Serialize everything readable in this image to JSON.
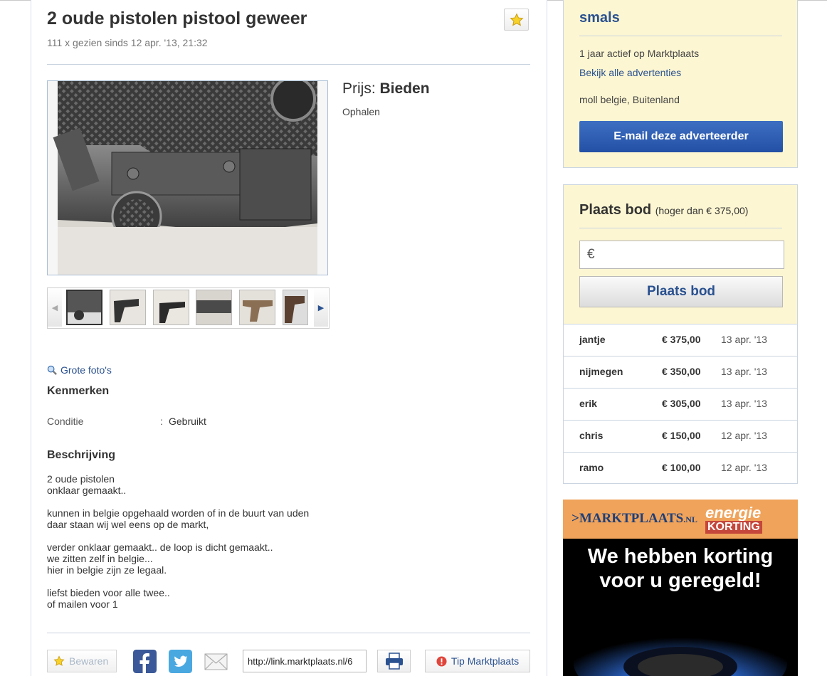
{
  "listing": {
    "title": "2 oude pistolen pistool geweer",
    "views": "111 x gezien sinds 12 apr. '13, 21:32",
    "price_label": "Prijs:",
    "price_value": "Bieden",
    "delivery": "Ophalen",
    "large_photos_link": "Grote foto's",
    "features_heading": "Kenmerken",
    "features": [
      {
        "label": "Conditie",
        "sep": ":",
        "value": "Gebruikt"
      }
    ],
    "description_heading": "Beschrijving",
    "description_paragraphs": [
      [
        "2 oude pistolen",
        "onklaar gemaakt.."
      ],
      [
        "kunnen in belgie opgehaald worden of in de buurt van uden",
        "daar staan wij wel eens op de markt,"
      ],
      [
        "verder onklaar gemaakt.. de loop is dicht gemaakt..",
        "we zitten zelf in belgie...",
        "hier in belgie zijn ze legaal."
      ],
      [
        "liefst bieden voor alle twee..",
        "of mailen voor 1"
      ]
    ]
  },
  "gallery": {
    "thumb_count": 6,
    "selected_index": 0,
    "prev_icon": "chevron-left-icon",
    "next_icon": "chevron-right-icon"
  },
  "share": {
    "save_label": "Bewaren",
    "link_url": "http://link.marktplaats.nl/6",
    "tip_label": "Tip Marktplaats"
  },
  "seller": {
    "name": "smals",
    "active": "1 jaar actief op Marktplaats",
    "all_ads_link": "Bekijk alle advertenties",
    "location": "moll belgie, Buitenland",
    "email_button": "E-mail deze adverteerder"
  },
  "bidding": {
    "title": "Plaats bod",
    "subtitle": "(hoger dan € 375,00)",
    "currency_symbol": "€",
    "button": "Plaats bod",
    "bids": [
      {
        "name": "jantje",
        "amount": "€ 375,00",
        "date": "13 apr. '13"
      },
      {
        "name": "nijmegen",
        "amount": "€ 350,00",
        "date": "13 apr. '13"
      },
      {
        "name": "erik",
        "amount": "€ 305,00",
        "date": "13 apr. '13"
      },
      {
        "name": "chris",
        "amount": "€ 150,00",
        "date": "12 apr. '13"
      },
      {
        "name": "ramo",
        "amount": "€ 100,00",
        "date": "12 apr. '13"
      }
    ]
  },
  "ad": {
    "brand": "MARKTPLAATS",
    "brand_suffix": ".NL",
    "badge_top": "energie",
    "badge_bottom": "KORTING",
    "line1": "We hebben korting",
    "line2": "voor u geregeld!"
  },
  "colors": {
    "link": "#2a5190",
    "sidebar_bg": "#fdf6d2",
    "primary_button": "#2350a5"
  }
}
